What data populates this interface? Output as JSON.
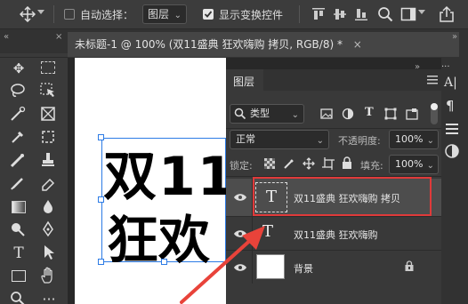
{
  "options": {
    "auto_select_label": "自动选择：",
    "auto_select_checked": false,
    "auto_select_target": "图层",
    "show_transform_label": "显示变换控件",
    "show_transform_checked": true
  },
  "document": {
    "tab_title": "未标题-1 @ 100% (双11盛典 狂欢嗨购 拷贝, RGB/8) *",
    "canvas_line1": "双11",
    "canvas_line2": "狂欢"
  },
  "layers_panel": {
    "title": "图层",
    "filter_label": "类型",
    "blend_mode": "正常",
    "opacity_label": "不透明度:",
    "opacity_value": "100%",
    "lock_label": "锁定:",
    "fill_label": "填充:",
    "fill_value": "100%",
    "layers": [
      {
        "name": "双11盛典 狂欢嗨购 拷贝",
        "type": "text",
        "selected": true
      },
      {
        "name": "双11盛典 狂欢嗨购",
        "type": "text",
        "selected": false
      },
      {
        "name": "背景",
        "type": "pixel",
        "locked": true
      }
    ],
    "thumb_text_glyph": "T"
  },
  "colors": {
    "highlight": "#e03a3a",
    "arrow": "#e8433a",
    "selection": "#2c7be5"
  }
}
